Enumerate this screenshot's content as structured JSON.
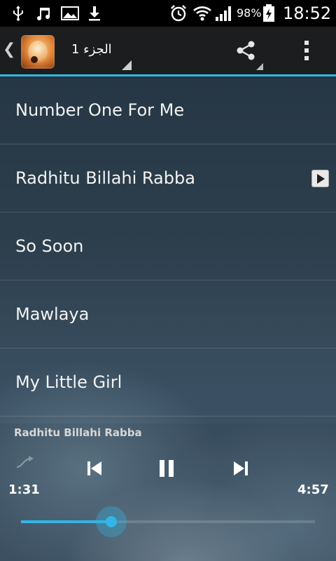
{
  "status_bar": {
    "battery": "98%",
    "time": "18:52",
    "icons": [
      "usb-icon",
      "music-note-icon",
      "image-icon",
      "download-icon",
      "alarm-icon",
      "wifi-icon",
      "signal-icon",
      "battery-charging-icon"
    ]
  },
  "action_bar": {
    "spinner_label": "الجزء 1",
    "share_icon": "share-icon",
    "overflow_icon": "more-vert-icon",
    "accent_color": "#33b5e5"
  },
  "tracks": [
    {
      "title": "Number One For Me",
      "playing": false
    },
    {
      "title": "Radhitu Billahi Rabba",
      "playing": true
    },
    {
      "title": "So Soon",
      "playing": false
    },
    {
      "title": "Mawlaya",
      "playing": false
    },
    {
      "title": "My Little Girl",
      "playing": false
    }
  ],
  "player": {
    "now_playing": "Radhitu Billahi Rabba",
    "current_time": "1:31",
    "total_time": "4:57",
    "progress": 0.306
  }
}
